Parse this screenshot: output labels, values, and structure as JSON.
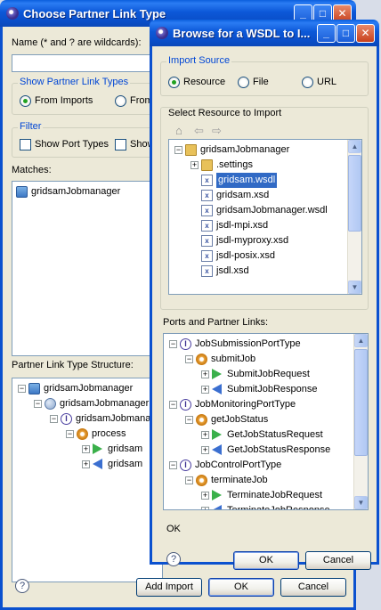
{
  "back": {
    "title": "Choose Partner Link Type",
    "name_label": "Name (* and ? are wildcards):",
    "name_value": "",
    "show_group_title": "Show Partner Link Types",
    "from_imports": "From Imports",
    "from_other": "From",
    "filter_title": "Filter",
    "show_port_types": "Show Port Types",
    "show_other": "Show",
    "matches_label": "Matches:",
    "matches": [
      "gridsamJobmanager"
    ],
    "structure_label": "Partner Link Type Structure:",
    "tree": [
      "gridsamJobmanager",
      "gridsamJobmanager",
      "gridsamJobmanager",
      "process",
      "gridsam",
      "gridsam"
    ],
    "add_import": "Add Import",
    "ok": "OK",
    "cancel": "Cancel"
  },
  "front": {
    "title": "Browse for a WSDL to I...",
    "import_source_title": "Import Source",
    "sources": {
      "resource": "Resource",
      "file": "File",
      "url": "URL"
    },
    "select_label": "Select Resource to Import",
    "resources": [
      {
        "label": "gridsamJobmanager",
        "kind": "folder"
      },
      {
        "label": ".settings",
        "kind": "folder"
      },
      {
        "label": "gridsam.wsdl",
        "kind": "file",
        "selected": true
      },
      {
        "label": "gridsam.xsd",
        "kind": "file"
      },
      {
        "label": "gridsamJobmanager.wsdl",
        "kind": "file"
      },
      {
        "label": "jsdl-mpi.xsd",
        "kind": "file"
      },
      {
        "label": "jsdl-myproxy.xsd",
        "kind": "file"
      },
      {
        "label": "jsdl-posix.xsd",
        "kind": "file"
      },
      {
        "label": "jsdl.xsd",
        "kind": "file"
      }
    ],
    "ports_label": "Ports and Partner Links:",
    "ports": [
      {
        "label": "JobSubmissionPortType",
        "kind": "porttype"
      },
      {
        "label": "submitJob",
        "kind": "op"
      },
      {
        "label": "SubmitJobRequest",
        "kind": "in"
      },
      {
        "label": "SubmitJobResponse",
        "kind": "out"
      },
      {
        "label": "JobMonitoringPortType",
        "kind": "porttype"
      },
      {
        "label": "getJobStatus",
        "kind": "op"
      },
      {
        "label": "GetJobStatusRequest",
        "kind": "in"
      },
      {
        "label": "GetJobStatusResponse",
        "kind": "out"
      },
      {
        "label": "JobControlPortType",
        "kind": "porttype"
      },
      {
        "label": "terminateJob",
        "kind": "op"
      },
      {
        "label": "TerminateJobRequest",
        "kind": "in"
      },
      {
        "label": "TerminateJobResponse",
        "kind": "out"
      }
    ],
    "status": "OK",
    "ok": "OK",
    "cancel": "Cancel"
  },
  "icons": {
    "help": "?",
    "minimize": "_",
    "maximize": "□",
    "close": "✕",
    "home": "⌂",
    "back": "⇦",
    "forward": "⇨"
  }
}
